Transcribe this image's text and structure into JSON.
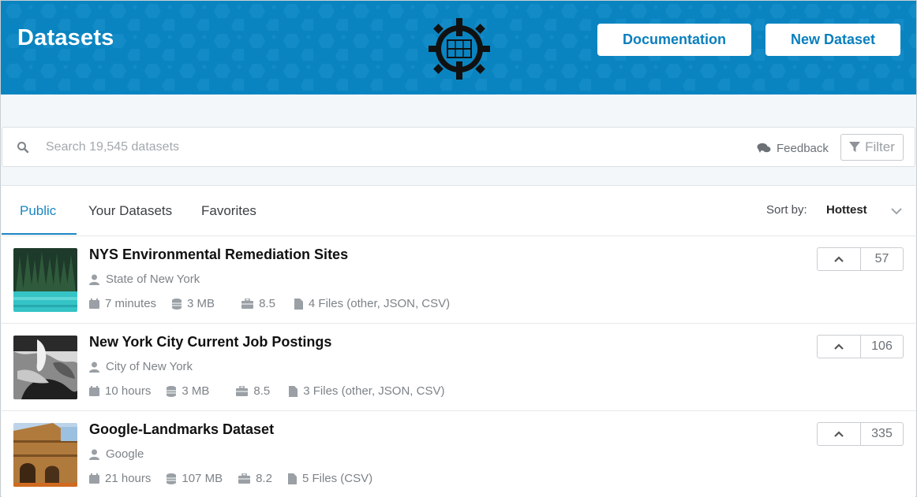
{
  "header": {
    "title": "Datasets",
    "documentation_label": "Documentation",
    "new_dataset_label": "New Dataset"
  },
  "search": {
    "placeholder": "Search 19,545 datasets",
    "feedback_label": "Feedback",
    "filter_label": "Filter"
  },
  "tabs": [
    {
      "label": "Public",
      "active": true
    },
    {
      "label": "Your Datasets",
      "active": false
    },
    {
      "label": "Favorites",
      "active": false
    }
  ],
  "sort": {
    "label": "Sort by:",
    "value": "Hottest"
  },
  "datasets": [
    {
      "title": "NYS Environmental Remediation Sites",
      "owner": "State of New York",
      "updated": "7 minutes",
      "size": "3 MB",
      "usability": "8.5",
      "files": "4 Files (other, JSON, CSV)",
      "votes": "57"
    },
    {
      "title": "New York City Current Job Postings",
      "owner": "City of New York",
      "updated": "10 hours",
      "size": "3 MB",
      "usability": "8.5",
      "files": "3 Files (other, JSON, CSV)",
      "votes": "106"
    },
    {
      "title": "Google-Landmarks Dataset",
      "owner": "Google",
      "updated": "21 hours",
      "size": "107 MB",
      "usability": "8.2",
      "files": "5 Files (CSV)",
      "votes": "335"
    }
  ],
  "colors": {
    "header_bg": "#0a84c0",
    "accent": "#1a86c4",
    "muted_text": "#7d8388"
  },
  "icons": [
    "search-icon",
    "feedback-icon",
    "filter-icon",
    "user-icon",
    "calendar-icon",
    "database-icon",
    "toolbox-icon",
    "file-icon",
    "upvote-chevron-icon",
    "chevron-down-icon"
  ]
}
